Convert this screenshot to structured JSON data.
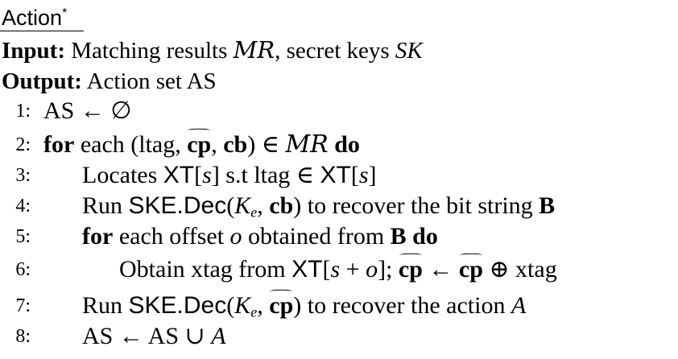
{
  "algorithm": {
    "title": "Action*",
    "input_label": "Input:",
    "input_text": "Matching results MR, secret keys SK",
    "output_label": "Output:",
    "output_text": "Action set AS",
    "lines": [
      {
        "num": "1:",
        "text": "AS ← ∅"
      },
      {
        "num": "2:",
        "text": "for each (ltag, cp̃, cb) ∈ MR do"
      },
      {
        "num": "3:",
        "text": "Locates XT[s] s.t ltag ∈ XT[s]"
      },
      {
        "num": "4:",
        "text": "Run SKE.Dec(Ke, cb) to recover the bit string B"
      },
      {
        "num": "5:",
        "text": "for each offset o obtained from B do"
      },
      {
        "num": "6:",
        "text": "Obtain xtag from XT[s + o]; cp̃ ← cp̃ ⊕ xtag"
      },
      {
        "num": "7:",
        "text": "Run SKE.Dec(Ke, cp̃) to recover the action A"
      },
      {
        "num": "8:",
        "text": "AS ← AS ∪ A"
      }
    ]
  }
}
